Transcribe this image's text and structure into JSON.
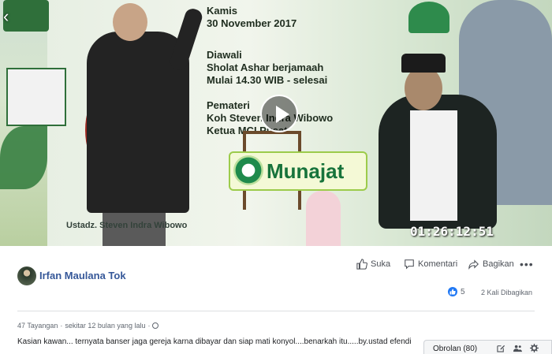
{
  "video": {
    "banner_date_line1": "Kamis",
    "banner_date_line2": "30 November 2017",
    "banner_info_line1": "Diawali",
    "banner_info_line2": "Sholat Ashar berjamaah",
    "banner_info_line3": "Mulai 14.30 WIB - selesai",
    "banner_pemateri_line1": "Pemateri",
    "banner_pemateri_line2": "Koh Steven Indra Wibowo",
    "banner_pemateri_line3": "Ketua MCI Pusat",
    "munajat_text": "Munajat",
    "speaker_caption": "Ustadz. Steven Indra Wibowo",
    "timecode": "01:26:12:51",
    "play_icon": "play-icon"
  },
  "post": {
    "author_name": "Irfan Maulana Tok",
    "actions": {
      "like_label": "Suka",
      "comment_label": "Komentari",
      "share_label": "Bagikan",
      "more_label": "•••"
    },
    "reaction_count": "5",
    "share_count_text": "2 Kali Dibagikan",
    "views_text": "47 Tayangan",
    "separator": "·",
    "time_text": "sekitar 12 bulan yang lalu",
    "description": "Kasian kawan... ternyata banser jaga gereja karna dibayar dan siap mati konyol....benarkah itu.....by.ustad efendi"
  },
  "chat_dock": {
    "label": "Obrolan (80)"
  },
  "colors": {
    "link_blue": "#365899",
    "like_blue": "#2078f4",
    "text_gray": "#606770"
  }
}
